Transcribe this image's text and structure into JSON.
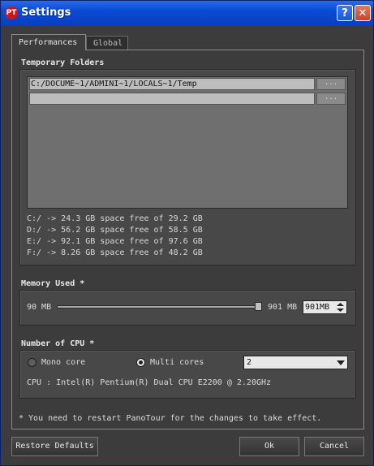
{
  "window": {
    "title": "Settings",
    "icon_text": "PT",
    "help_glyph": "?",
    "close_glyph": "✕"
  },
  "tabs": [
    {
      "label": "Performances",
      "active": true
    },
    {
      "label": "Global",
      "active": false
    }
  ],
  "temp_folders": {
    "title": "Temporary Folders",
    "folders": [
      {
        "path": "C:/DOCUME~1/ADMINI~1/LOCALS~1/Temp",
        "browse": "..."
      },
      {
        "path": "",
        "browse": "..."
      }
    ],
    "disks": [
      "C:/ -> 24.3 GB space free of 29.2 GB",
      "D:/ -> 56.2 GB space free of 58.5 GB",
      "E:/ -> 92.1 GB space free of 97.6 GB",
      "F:/ -> 8.26 GB space free of 48.2 GB"
    ]
  },
  "memory": {
    "title": "Memory Used *",
    "min_label": "90 MB",
    "max_label": "901 MB",
    "value": "901MB",
    "slider_fraction": 1.0
  },
  "cpu": {
    "title": "Number of CPU *",
    "mono_label": "Mono core",
    "multi_label": "Multi cores",
    "selected": "multi",
    "cores_value": "2",
    "cpu_info": "CPU : Intel(R) Pentium(R) Dual  CPU  E2200  @ 2.20GHz"
  },
  "restart_note": "* You need to restart PanoTour for the changes to take effect.",
  "buttons": {
    "restore": "Restore Defaults",
    "ok": "Ok",
    "cancel": "Cancel"
  }
}
